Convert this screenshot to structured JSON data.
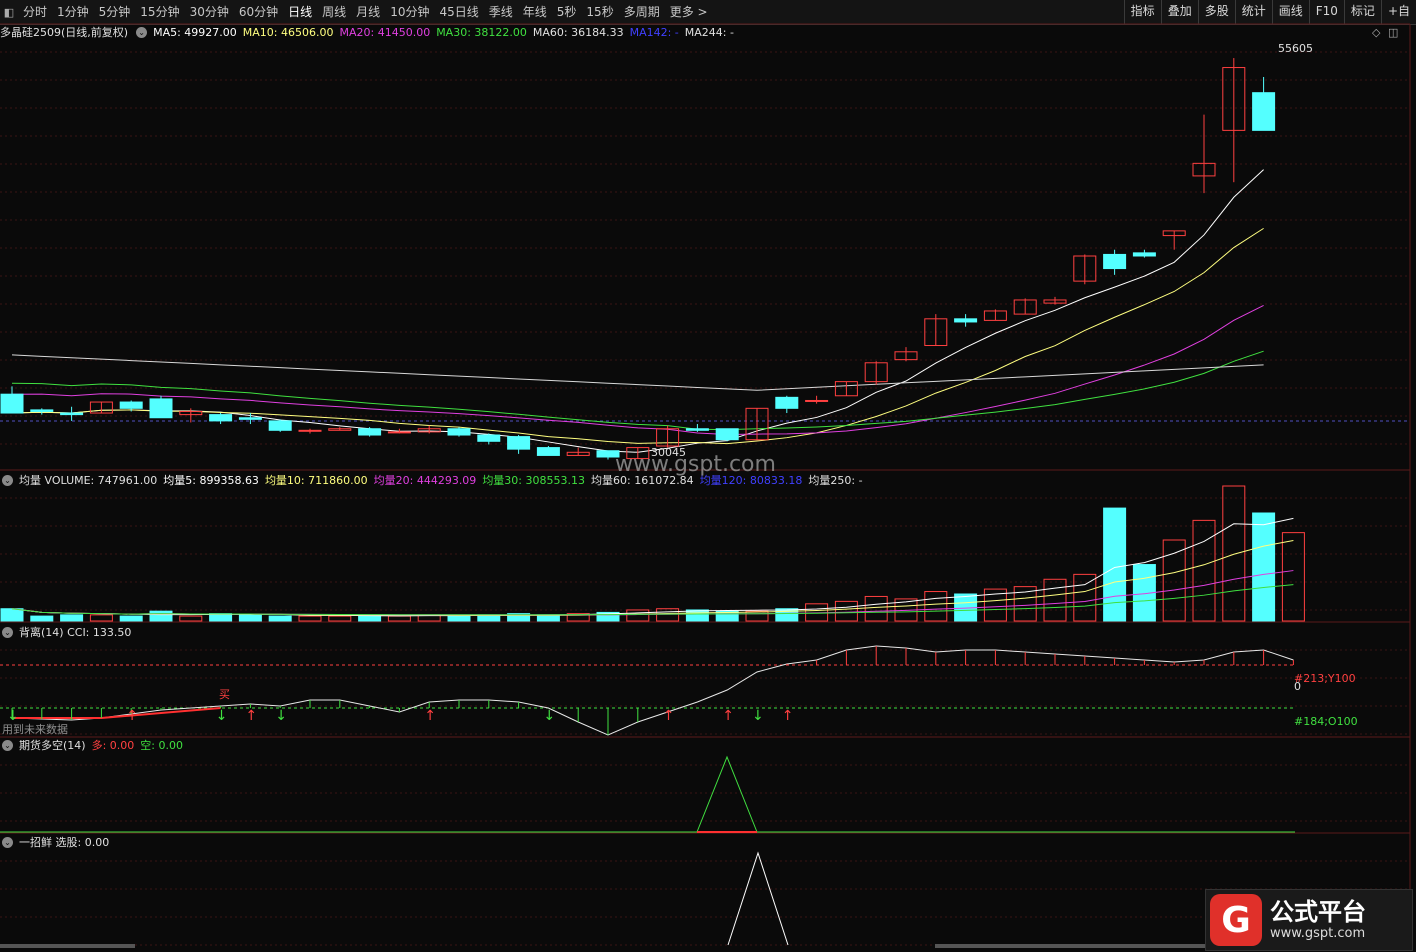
{
  "toolbar": {
    "periods": [
      "分时",
      "1分钟",
      "5分钟",
      "15分钟",
      "30分钟",
      "60分钟",
      "日线",
      "周线",
      "月线",
      "10分钟",
      "45日线",
      "季线",
      "年线",
      "5秒",
      "15秒",
      "多周期",
      "更多 >"
    ],
    "active_period": "日线",
    "right_buttons": [
      "指标",
      "叠加",
      "多股",
      "统计",
      "画线",
      "F10",
      "标记",
      "+自"
    ]
  },
  "main_legend": {
    "title": "多晶硅2509(日线,前复权)",
    "items": [
      {
        "label": "MA5: 49927.00",
        "color": "#ffffff"
      },
      {
        "label": "MA10: 46506.00",
        "color": "#ffff80"
      },
      {
        "label": "MA20: 41450.00",
        "color": "#e040e0"
      },
      {
        "label": "MA30: 38122.00",
        "color": "#40e040"
      },
      {
        "label": "MA60: 36184.33",
        "color": "#e0e0e0"
      },
      {
        "label": "MA142: -",
        "color": "#4040ff"
      },
      {
        "label": "MA244: -",
        "color": "#e0e0e0"
      }
    ]
  },
  "main_annotations": {
    "high": "55605",
    "low": "30045"
  },
  "volume_legend": {
    "items": [
      {
        "label": "均量 VOLUME: 747961.00",
        "color": "#e0e0e0"
      },
      {
        "label": "均量5: 899358.63",
        "color": "#ffffff"
      },
      {
        "label": "均量10: 711860.00",
        "color": "#ffff80"
      },
      {
        "label": "均量20: 444293.09",
        "color": "#e040e0"
      },
      {
        "label": "均量30: 308553.13",
        "color": "#40e040"
      },
      {
        "label": "均量60: 161072.84",
        "color": "#e0e0e0"
      },
      {
        "label": "均量120: 80833.18",
        "color": "#4040ff"
      },
      {
        "label": "均量250: -",
        "color": "#e0e0e0"
      }
    ]
  },
  "cci_legend": {
    "items": [
      {
        "label": "背离(14)  CCI: 133.50",
        "color": "#e0e0e0"
      }
    ]
  },
  "cci_annotations": {
    "buy": "买",
    "future": "用到未来数据",
    "upper": "#213;Y100",
    "zero": "0",
    "lower": "#184;O100"
  },
  "futures_legend": {
    "items": [
      {
        "label": "期货多空(14)",
        "color": "#e0e0e0"
      },
      {
        "label": "多: 0.00",
        "color": "#ff4040"
      },
      {
        "label": "空: 0.00",
        "color": "#40e040"
      }
    ]
  },
  "pick_legend": {
    "items": [
      {
        "label": "一招鲜  选股: 0.00",
        "color": "#e0e0e0"
      }
    ]
  },
  "watermark": "www.gspt.com",
  "logo": {
    "title": "公式平台",
    "url": "www.gspt.com",
    "glyph": "G"
  },
  "colors": {
    "up": "#ff4040",
    "down": "#54ffff",
    "bg": "#0a0a0a"
  },
  "chart_data": {
    "type": "candlestick",
    "price_high": 55605,
    "price_low": 30045,
    "candles": [
      {
        "o": 34200,
        "h": 34700,
        "l": 33000,
        "c": 33000
      },
      {
        "o": 33200,
        "h": 33300,
        "l": 32900,
        "c": 33100
      },
      {
        "o": 33000,
        "h": 33400,
        "l": 32500,
        "c": 32900
      },
      {
        "o": 33000,
        "h": 33700,
        "l": 33000,
        "c": 33700
      },
      {
        "o": 33700,
        "h": 33800,
        "l": 33100,
        "c": 33300
      },
      {
        "o": 33900,
        "h": 34100,
        "l": 32700,
        "c": 32700
      },
      {
        "o": 32900,
        "h": 33300,
        "l": 32400,
        "c": 33100
      },
      {
        "o": 32900,
        "h": 33000,
        "l": 32300,
        "c": 32500
      },
      {
        "o": 32700,
        "h": 33000,
        "l": 32300,
        "c": 32600
      },
      {
        "o": 32500,
        "h": 32600,
        "l": 31800,
        "c": 31900
      },
      {
        "o": 31900,
        "h": 32000,
        "l": 31700,
        "c": 31900
      },
      {
        "o": 31900,
        "h": 32100,
        "l": 31900,
        "c": 32000
      },
      {
        "o": 32000,
        "h": 32100,
        "l": 31500,
        "c": 31600
      },
      {
        "o": 31800,
        "h": 32000,
        "l": 31700,
        "c": 31800
      },
      {
        "o": 31800,
        "h": 32200,
        "l": 31700,
        "c": 32000
      },
      {
        "o": 32000,
        "h": 32100,
        "l": 31500,
        "c": 31600
      },
      {
        "o": 31600,
        "h": 31700,
        "l": 31000,
        "c": 31200
      },
      {
        "o": 31500,
        "h": 31600,
        "l": 30400,
        "c": 30700
      },
      {
        "o": 30800,
        "h": 30900,
        "l": 30300,
        "c": 30300
      },
      {
        "o": 30300,
        "h": 30800,
        "l": 30300,
        "c": 30500
      },
      {
        "o": 30600,
        "h": 30600,
        "l": 30045,
        "c": 30200
      },
      {
        "o": 30100,
        "h": 30800,
        "l": 30100,
        "c": 30800
      },
      {
        "o": 30900,
        "h": 32200,
        "l": 30800,
        "c": 32000
      },
      {
        "o": 32000,
        "h": 32300,
        "l": 31800,
        "c": 31900
      },
      {
        "o": 32000,
        "h": 32000,
        "l": 31200,
        "c": 31300
      },
      {
        "o": 31300,
        "h": 33300,
        "l": 31300,
        "c": 33300
      },
      {
        "o": 34000,
        "h": 34100,
        "l": 33000,
        "c": 33300
      },
      {
        "o": 33800,
        "h": 34100,
        "l": 33600,
        "c": 33800
      },
      {
        "o": 34100,
        "h": 35000,
        "l": 34100,
        "c": 35000
      },
      {
        "o": 35000,
        "h": 36300,
        "l": 34800,
        "c": 36200
      },
      {
        "o": 36400,
        "h": 37200,
        "l": 36300,
        "c": 36900
      },
      {
        "o": 37300,
        "h": 39300,
        "l": 37300,
        "c": 39000
      },
      {
        "o": 39000,
        "h": 39300,
        "l": 38500,
        "c": 38800
      },
      {
        "o": 38900,
        "h": 39600,
        "l": 38900,
        "c": 39500
      },
      {
        "o": 39300,
        "h": 40300,
        "l": 39300,
        "c": 40200
      },
      {
        "o": 40000,
        "h": 40400,
        "l": 39900,
        "c": 40200
      },
      {
        "o": 41400,
        "h": 43100,
        "l": 41200,
        "c": 43000
      },
      {
        "o": 43100,
        "h": 43400,
        "l": 41800,
        "c": 42200
      },
      {
        "o": 43200,
        "h": 43400,
        "l": 42900,
        "c": 43000
      },
      {
        "o": 44300,
        "h": 44600,
        "l": 43400,
        "c": 44600
      },
      {
        "o": 48100,
        "h": 52000,
        "l": 47000,
        "c": 48900
      },
      {
        "o": 51000,
        "h": 55605,
        "l": 47700,
        "c": 55000
      },
      {
        "o": 53400,
        "h": 54400,
        "l": 51100,
        "c": 51000
      }
    ],
    "volume": [
      10,
      4,
      5,
      5,
      4,
      8,
      4,
      6,
      5,
      4,
      4,
      4,
      5,
      4,
      5,
      4,
      5,
      6,
      5,
      6,
      7,
      9,
      10,
      9,
      8,
      8,
      10,
      14,
      16,
      20,
      18,
      24,
      22,
      26,
      28,
      34,
      38,
      92,
      46,
      66,
      82,
      110,
      88,
      72
    ]
  }
}
